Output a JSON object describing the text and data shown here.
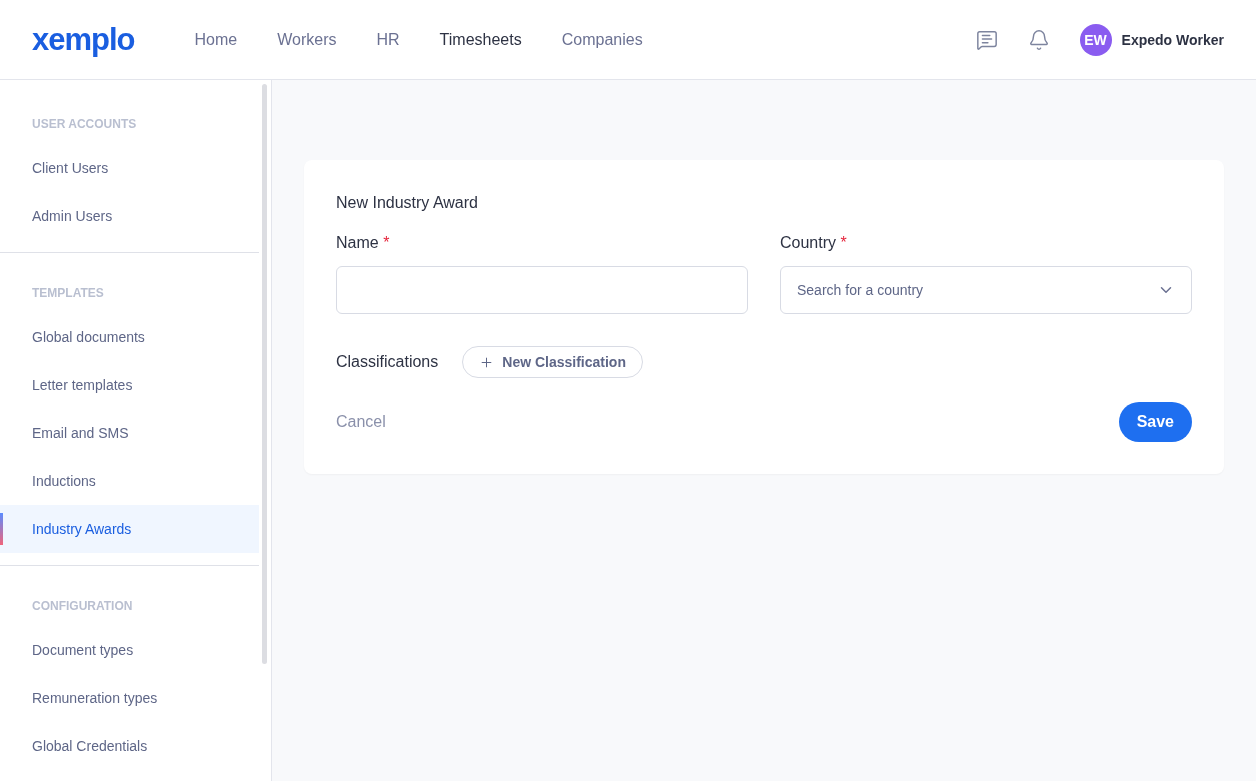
{
  "header": {
    "logo": "xemplo",
    "nav": [
      {
        "label": "Home",
        "selected": false
      },
      {
        "label": "Workers",
        "selected": false
      },
      {
        "label": "HR",
        "selected": false
      },
      {
        "label": "Timesheets",
        "selected": true
      },
      {
        "label": "Companies",
        "selected": false
      }
    ],
    "user": {
      "initials": "EW",
      "name": "Expedo Worker"
    }
  },
  "sidebar": {
    "sections": [
      {
        "title": "USER ACCOUNTS",
        "items": [
          {
            "label": "Client Users",
            "selected": false
          },
          {
            "label": "Admin Users",
            "selected": false
          }
        ]
      },
      {
        "title": "TEMPLATES",
        "items": [
          {
            "label": "Global documents",
            "selected": false
          },
          {
            "label": "Letter templates",
            "selected": false
          },
          {
            "label": "Email and SMS",
            "selected": false
          },
          {
            "label": "Inductions",
            "selected": false
          },
          {
            "label": "Industry Awards",
            "selected": true
          }
        ]
      },
      {
        "title": "CONFIGURATION",
        "items": [
          {
            "label": "Document types",
            "selected": false
          },
          {
            "label": "Remuneration types",
            "selected": false
          },
          {
            "label": "Global Credentials",
            "selected": false
          }
        ]
      }
    ]
  },
  "form": {
    "title": "New Industry Award",
    "fields": [
      {
        "kind": "text",
        "label": "Name",
        "required": "*"
      },
      {
        "kind": "select",
        "label": "Country",
        "required": "*",
        "placeholder": "Search for a country"
      }
    ],
    "classifications": {
      "label": "Classifications",
      "button": "New Classification"
    },
    "cancel": "Cancel",
    "save": "Save"
  }
}
